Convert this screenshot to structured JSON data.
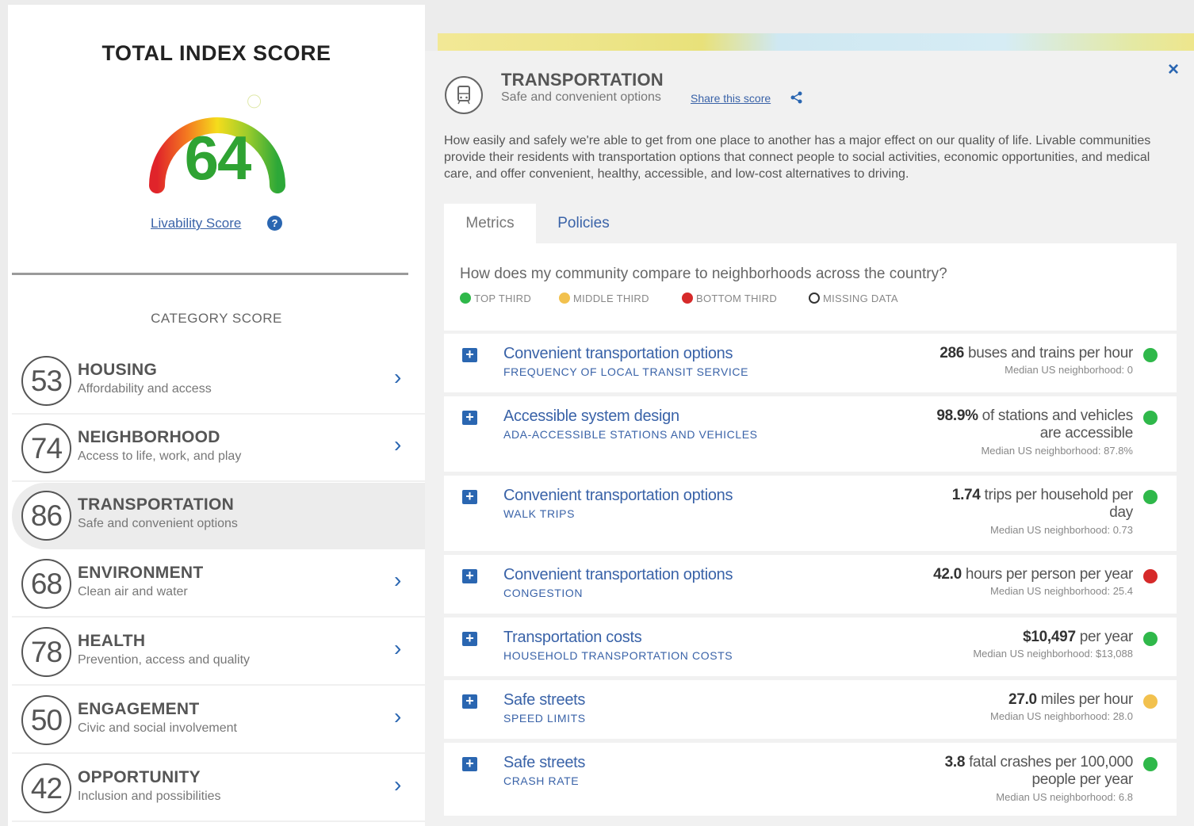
{
  "total": {
    "title": "TOTAL INDEX SCORE",
    "score": "64",
    "score_fraction": 0.64,
    "link": "Livability Score",
    "help_icon": "question-circle-icon"
  },
  "categories_title": "CATEGORY SCORE",
  "categories": [
    {
      "score": "53",
      "name": "HOUSING",
      "sub": "Affordability and access"
    },
    {
      "score": "74",
      "name": "NEIGHBORHOOD",
      "sub": "Access to life, work, and play"
    },
    {
      "score": "86",
      "name": "TRANSPORTATION",
      "sub": "Safe and convenient options",
      "active": true
    },
    {
      "score": "68",
      "name": "ENVIRONMENT",
      "sub": "Clean air and water"
    },
    {
      "score": "78",
      "name": "HEALTH",
      "sub": "Prevention, access and quality"
    },
    {
      "score": "50",
      "name": "ENGAGEMENT",
      "sub": "Civic and social involvement"
    },
    {
      "score": "42",
      "name": "OPPORTUNITY",
      "sub": "Inclusion and possibilities"
    }
  ],
  "detail": {
    "close": "×",
    "icon": "transportation-icon",
    "title": "TRANSPORTATION",
    "subtitle": "Safe and convenient options",
    "share": "Share this score",
    "description": "How easily and safely we're able to get from one place to another has a major effect on our quality of life. Livable communities provide their residents with transportation options that connect people to social activities, economic opportunities, and medical care, and offer convenient, healthy, accessible, and low-cost alternatives to driving.",
    "tabs": [
      "Metrics",
      "Policies"
    ],
    "question": "How does my community compare to neighborhoods across the country?",
    "legend": [
      {
        "label": "TOP THIRD",
        "color": "#2fb84a"
      },
      {
        "label": "MIDDLE THIRD",
        "color": "#f2c14e"
      },
      {
        "label": "BOTTOM THIRD",
        "color": "#d62a2a"
      },
      {
        "label": "MISSING DATA",
        "color": "#ffffff"
      }
    ]
  },
  "metrics": [
    {
      "title": "Convenient transportation options",
      "sub": "FREQUENCY OF LOCAL TRANSIT SERVICE",
      "value_num": "286",
      "value_text": " buses and trains per hour",
      "value_text2": "",
      "median": "Median US neighborhood: 0",
      "color": "#2fb84a"
    },
    {
      "title": "Accessible system design",
      "sub": "ADA-ACCESSIBLE STATIONS AND VEHICLES",
      "value_num": "98.9%",
      "value_text": " of stations and vehicles",
      "value_text2": "are accessible",
      "median": "Median US neighborhood: 87.8%",
      "color": "#2fb84a"
    },
    {
      "title": "Convenient transportation options",
      "sub": "WALK TRIPS",
      "value_num": "1.74",
      "value_text": " trips per household per",
      "value_text2": "day",
      "median": "Median US neighborhood: 0.73",
      "color": "#2fb84a"
    },
    {
      "title": "Convenient transportation options",
      "sub": "CONGESTION",
      "value_num": "42.0",
      "value_text": " hours per person per year",
      "value_text2": "",
      "median": "Median US neighborhood: 25.4",
      "color": "#d62a2a"
    },
    {
      "title": "Transportation costs",
      "sub": "HOUSEHOLD TRANSPORTATION COSTS",
      "value_num": "$10,497",
      "value_text": " per year",
      "value_text2": "",
      "median": "Median US neighborhood: $13,088",
      "color": "#2fb84a"
    },
    {
      "title": "Safe streets",
      "sub": "SPEED LIMITS",
      "value_num": "27.0",
      "value_text": " miles per hour",
      "value_text2": "",
      "median": "Median US neighborhood: 28.0",
      "color": "#f2c14e"
    },
    {
      "title": "Safe streets",
      "sub": "CRASH RATE",
      "value_num": "3.8",
      "value_text": " fatal crashes per 100,000",
      "value_text2": "people per year",
      "median": "Median US neighborhood: 6.8",
      "color": "#2fb84a"
    }
  ]
}
